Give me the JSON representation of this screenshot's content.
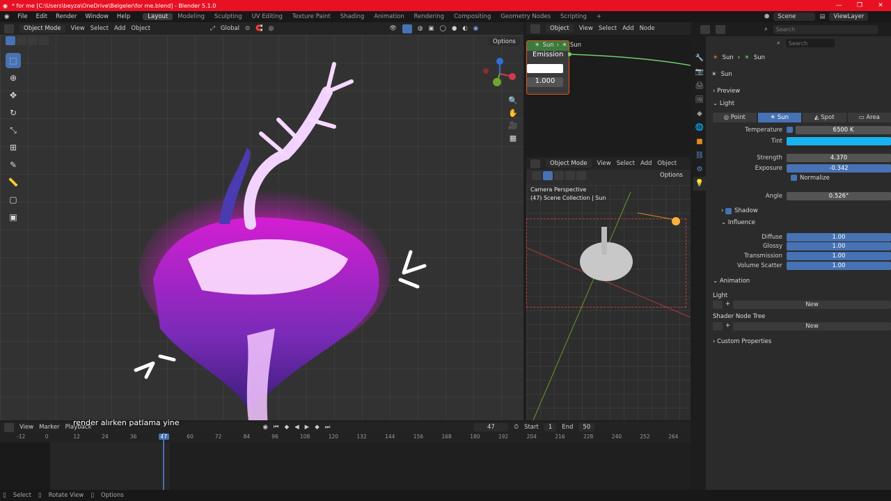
{
  "window": {
    "title": "* for me [C:\\Users\\beyza\\OneDrive\\Belgeler\\for me.blend] - Blender 5.1.0",
    "controls": [
      "—",
      "❐",
      "✕"
    ]
  },
  "menus": [
    "File",
    "Edit",
    "Render",
    "Window",
    "Help"
  ],
  "workspaces": [
    "Layout",
    "Modeling",
    "Sculpting",
    "UV Editing",
    "Texture Paint",
    "Shading",
    "Animation",
    "Rendering",
    "Compositing",
    "Geometry Nodes",
    "Scripting"
  ],
  "active_workspace": "Layout",
  "scene": {
    "name": "Scene",
    "view_layer": "ViewLayer"
  },
  "viewport": {
    "mode": "Object Mode",
    "menus": [
      "View",
      "Select",
      "Add",
      "Object"
    ],
    "orientation": "Global",
    "options_label": "Options",
    "tool_icons": [
      "select-box-icon",
      "cursor-icon",
      "move-icon",
      "rotate-icon",
      "scale-icon",
      "transform-icon",
      "annotate-icon",
      "measure-icon",
      "add-cube-icon",
      "camera-icon"
    ]
  },
  "node_editor": {
    "object": "Object",
    "menus": [
      "View",
      "Select",
      "Add",
      "Node"
    ],
    "breadcrumb_a": "Sun",
    "breadcrumb_b": "Sun",
    "node_title": "Emission",
    "strength_value": "1.000"
  },
  "camera_view": {
    "mode": "Object Mode",
    "menus": [
      "View",
      "Select",
      "Add",
      "Object"
    ],
    "options_label": "Options",
    "label": "Camera Perspective",
    "collection": "(47) Scene Collection | Sun"
  },
  "outliner": {
    "search_placeholder": "Search"
  },
  "properties": {
    "search_placeholder": "Search",
    "breadcrumb": [
      "Sun",
      "Sun"
    ],
    "datablock": "Sun",
    "sections": {
      "preview": "Preview",
      "light": "Light",
      "shadow": "Shadow",
      "influence": "Influence",
      "animation": "Animation",
      "custom": "Custom Properties"
    },
    "light_types": [
      "Point",
      "Sun",
      "Spot",
      "Area"
    ],
    "active_light_type": "Sun",
    "temperature_label": "Temperature",
    "temperature_value": "6500 K",
    "tint_label": "Tint",
    "tint_color": "#19b3f0",
    "strength_label": "Strength",
    "strength_value": "4.370",
    "exposure_label": "Exposure",
    "exposure_value": "-0.342",
    "normalize_label": "Normalize",
    "angle_label": "Angle",
    "angle_value": "0.526°",
    "influence": [
      {
        "label": "Diffuse",
        "value": "1.00"
      },
      {
        "label": "Glossy",
        "value": "1.00"
      },
      {
        "label": "Transmission",
        "value": "1.00"
      },
      {
        "label": "Volume Scatter",
        "value": "1.00"
      }
    ],
    "anim_light_label": "Light",
    "anim_shader_label": "Shader Node Tree",
    "new_label": "New"
  },
  "timeline": {
    "menus": [
      "View",
      "Marker",
      "Playback"
    ],
    "current_frame": "47",
    "start_label": "Start",
    "start_value": "1",
    "end_label": "End",
    "end_value": "50",
    "ticks": [
      "-12",
      "0",
      "12",
      "24",
      "36",
      "47",
      "60",
      "72",
      "84",
      "96",
      "108",
      "120",
      "132",
      "144",
      "156",
      "168",
      "180",
      "192",
      "204",
      "216",
      "228",
      "240",
      "252",
      "264"
    ]
  },
  "subtitle": "render alırken patlama yine",
  "status": [
    "Select",
    "Rotate View",
    "Options"
  ],
  "colors": {
    "accent": "#4772b3",
    "title_bar": "#e81123",
    "glow": "#ff2be8"
  }
}
